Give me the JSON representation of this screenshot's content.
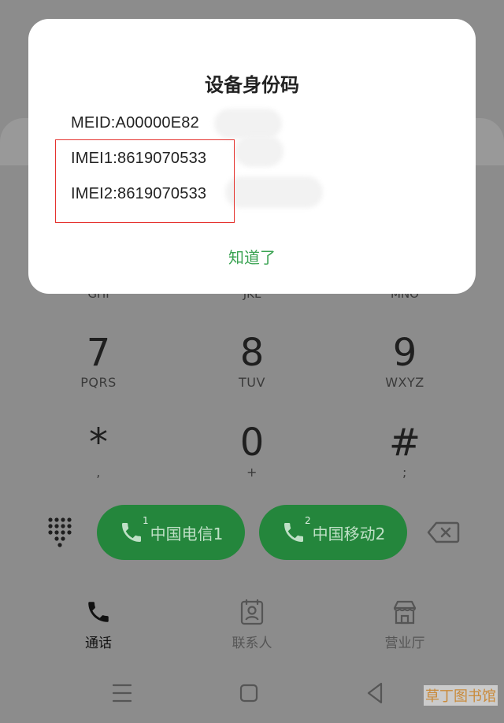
{
  "dialog": {
    "title": "设备身份码",
    "meid": "MEID:A00000E82",
    "imei1": "IMEI1:8619070533",
    "imei2": "IMEI2:8619070533",
    "ok_label": "知道了"
  },
  "keypad": {
    "partial_row": [
      "GHI",
      "JKL",
      "MNO"
    ],
    "keys": [
      {
        "digit": "7",
        "sub": "PQRS"
      },
      {
        "digit": "8",
        "sub": "TUV"
      },
      {
        "digit": "9",
        "sub": "WXYZ"
      },
      {
        "digit": "*",
        "sub": ","
      },
      {
        "digit": "0",
        "sub": "+"
      },
      {
        "digit": "#",
        "sub": ";"
      }
    ]
  },
  "call_buttons": [
    {
      "label": "中国电信1",
      "sim": "1"
    },
    {
      "label": "中国移动2",
      "sim": "2"
    }
  ],
  "bottom_nav": [
    {
      "label": "通话",
      "icon": "phone-icon",
      "active": true
    },
    {
      "label": "联系人",
      "icon": "contacts-icon",
      "active": false
    },
    {
      "label": "营业厅",
      "icon": "store-icon",
      "active": false
    }
  ],
  "watermark": "草丁图书馆",
  "colors": {
    "accent_green": "#3aa352",
    "call_button": "#24863c",
    "highlight_red": "#e5332f"
  }
}
